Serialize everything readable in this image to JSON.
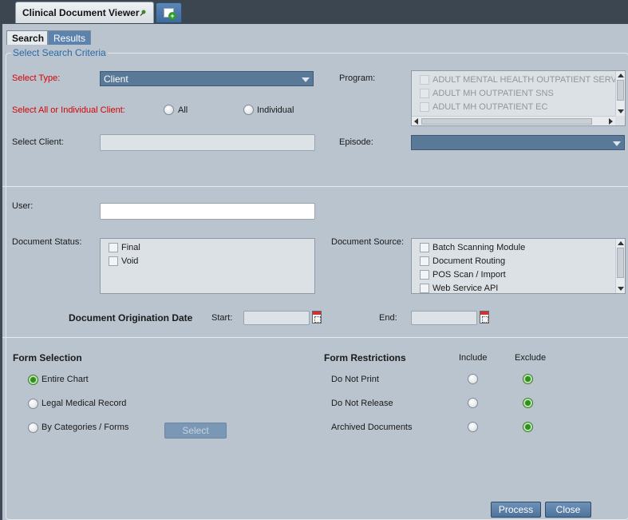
{
  "window": {
    "tab_title": "Clinical Document Viewer"
  },
  "tabs": {
    "search": "Search",
    "results": "Results"
  },
  "group_title": "Select Search Criteria",
  "select_type": {
    "label": "Select Type:",
    "value": "Client"
  },
  "select_client_scope": {
    "label": "Select All or Individual Client:",
    "options": [
      "All",
      "Individual"
    ],
    "selected": null
  },
  "select_client": {
    "label": "Select Client:",
    "value": ""
  },
  "program": {
    "label": "Program:",
    "items": [
      "ADULT MENTAL HEALTH OUTPATIENT SERVICE",
      "ADULT MH OUTPATIENT SNS",
      "ADULT MH OUTPATIENT EC"
    ]
  },
  "episode": {
    "label": "Episode:",
    "value": ""
  },
  "user": {
    "label": "User:",
    "value": ""
  },
  "document_status": {
    "label": "Document Status:",
    "items": [
      "Final",
      "Void"
    ]
  },
  "document_source": {
    "label": "Document Source:",
    "items": [
      "Batch Scanning Module",
      "Document Routing",
      "POS Scan / Import",
      "Web Service API"
    ]
  },
  "origination_date": {
    "label": "Document Origination Date",
    "start_label": "Start:",
    "end_label": "End:",
    "start": "",
    "end": ""
  },
  "form_selection": {
    "title": "Form Selection",
    "options": [
      "Entire Chart",
      "Legal Medical Record",
      "By Categories / Forms"
    ],
    "selected": "Entire Chart",
    "select_button": "Select"
  },
  "form_restrictions": {
    "title": "Form Restrictions",
    "include_label": "Include",
    "exclude_label": "Exclude",
    "rows": [
      {
        "label": "Do Not Print",
        "choice": "Exclude"
      },
      {
        "label": "Do Not Release",
        "choice": "Exclude"
      },
      {
        "label": "Archived Documents",
        "choice": "Exclude"
      }
    ]
  },
  "footer": {
    "process": "Process",
    "close": "Close"
  },
  "colors": {
    "required_label": "#d80000",
    "accent_blue": "#2a6aa6",
    "panel_bg": "#b9c4ce",
    "selected_radio": "#2f8f1f"
  },
  "icons": [
    "pin-icon",
    "add-document-icon",
    "chevron-down-icon",
    "calendar-icon"
  ]
}
